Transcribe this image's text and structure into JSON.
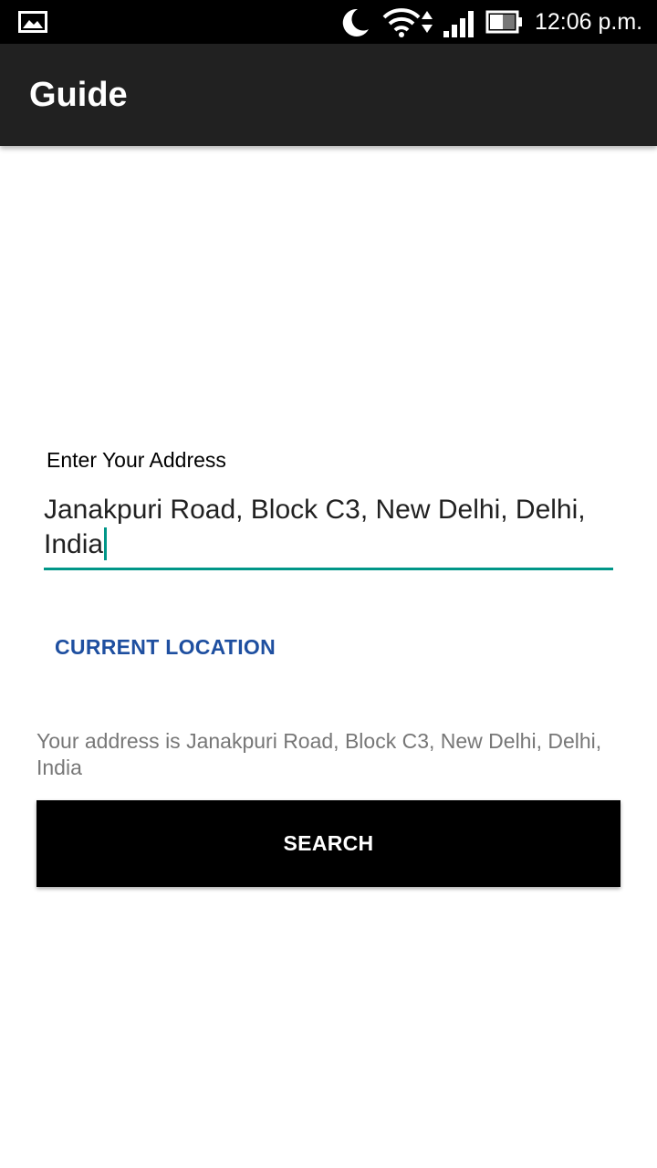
{
  "status_bar": {
    "time": "12:06 p.m.",
    "icons": [
      "gallery-icon",
      "moon-icon",
      "wifi-icon",
      "data-arrows-icon",
      "signal-icon",
      "battery-icon"
    ]
  },
  "app_bar": {
    "title": "Guide"
  },
  "form": {
    "address_label": "Enter Your Address",
    "address_value": "Janakpuri Road, Block C3, New Delhi, Delhi, India",
    "current_location_label": "CURRENT LOCATION",
    "address_result": "Your address is Janakpuri Road, Block C3, New Delhi, Delhi, India",
    "search_label": "SEARCH"
  },
  "colors": {
    "accent": "#009688",
    "link": "#1e4fa0",
    "app_bar": "#212121",
    "button": "#000000"
  }
}
